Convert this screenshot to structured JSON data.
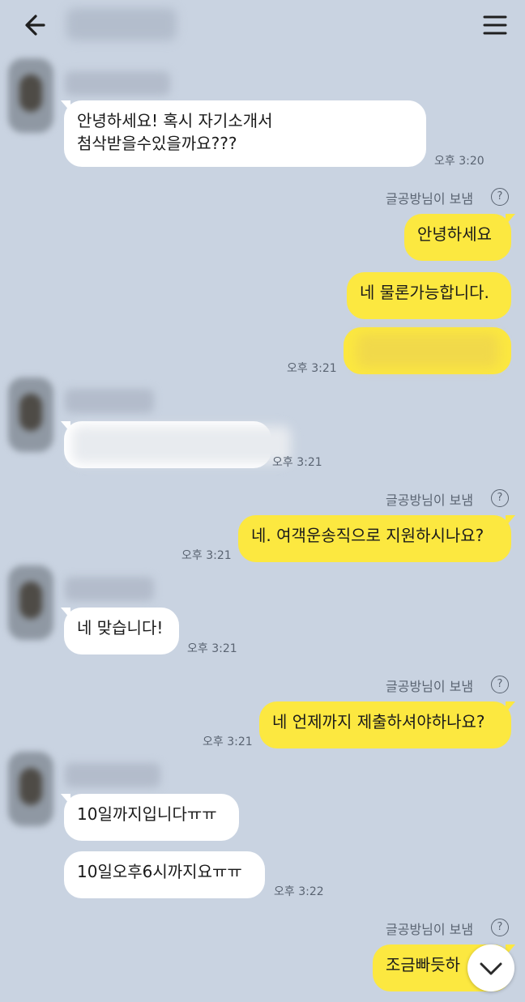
{
  "header": {
    "back_icon": "arrow-left-icon",
    "menu_icon": "hamburger-menu-icon"
  },
  "sent_by_label": "글공방님이 보냄",
  "help_glyph": "?",
  "messages": [
    {
      "lines": [
        "안녕하세요! 혹시 자기소개서",
        "첨삭받을수있을까요???"
      ],
      "time": "오후 3:20"
    },
    {
      "text": "안녕하세요"
    },
    {
      "text": "네 물론가능합니다."
    },
    {
      "time": "오후 3:21"
    },
    {
      "time": "오후 3:21"
    },
    {
      "text": "네. 여객운송직으로 지원하시나요?",
      "time": "오후 3:21"
    },
    {
      "text": "네 맞습니다!",
      "time": "오후 3:21"
    },
    {
      "text": "네 언제까지 제출하셔야하나요?",
      "time": "오후 3:21"
    },
    {
      "text": "10일까지입니다ㅠㅠ"
    },
    {
      "text": "10일오후6시까지요ㅠㅠ",
      "time": "오후 3:22"
    },
    {
      "text": "조금빠듯하"
    }
  ],
  "scroll_down_icon": "chevron-down-icon",
  "colors": {
    "background": "#c9d3e1",
    "incoming": "#ffffff",
    "outgoing": "#fce840"
  }
}
